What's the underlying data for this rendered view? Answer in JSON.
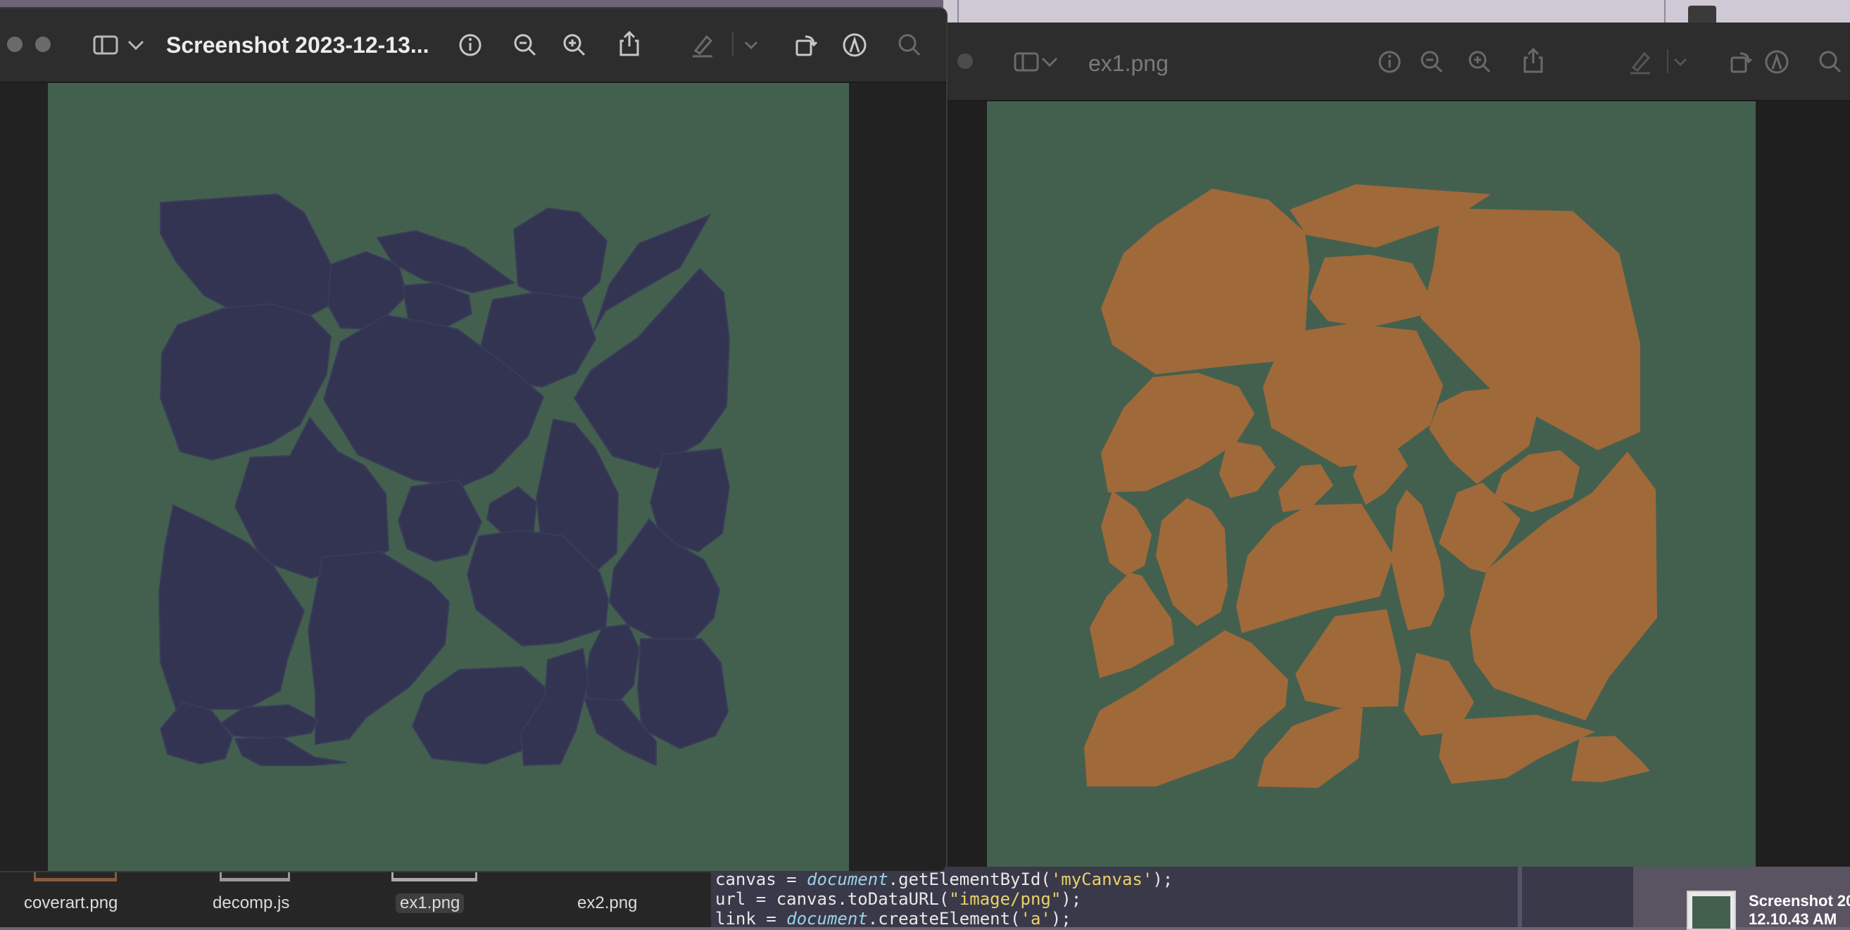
{
  "left_window": {
    "title": "Screenshot 2023-12-13...",
    "toolbar_icons": [
      "sidebar-icon",
      "chevron-down-icon",
      "info-icon",
      "zoom-out-icon",
      "zoom-in-icon",
      "share-icon",
      "markup-pen-icon",
      "chevron-down-icon",
      "rotate-icon",
      "annotate-icon",
      "search-icon"
    ],
    "canvas_color": "#43604f",
    "shape_color": "#323451"
  },
  "right_window": {
    "title": "ex1.png",
    "toolbar_icons": [
      "sidebar-icon",
      "chevron-down-icon",
      "info-icon",
      "zoom-out-icon",
      "zoom-in-icon",
      "share-icon",
      "markup-pen-icon",
      "chevron-down-icon",
      "rotate-icon",
      "annotate-icon",
      "search-icon"
    ],
    "canvas_color": "#43604f",
    "shape_color": "#a0693a"
  },
  "finder_files": [
    "coverart.png",
    "decomp.js",
    "ex1.png",
    "ex2.png"
  ],
  "selected_file": "ex1.png",
  "code_lines": [
    {
      "a": "canvas = ",
      "b": "document",
      "c": ".getElementById(",
      "d": "'myCanvas'",
      "e": ");"
    },
    {
      "a": "url = canvas.toDataURL(",
      "d": "\"image/png\"",
      "e": ");"
    },
    {
      "a": "link = ",
      "b": "document",
      "c": ".createElement(",
      "d": "'a'",
      "e": ");"
    }
  ],
  "desktop_screenshot": {
    "line1": "Screenshot 20",
    "line2": "12.10.43 AM"
  }
}
